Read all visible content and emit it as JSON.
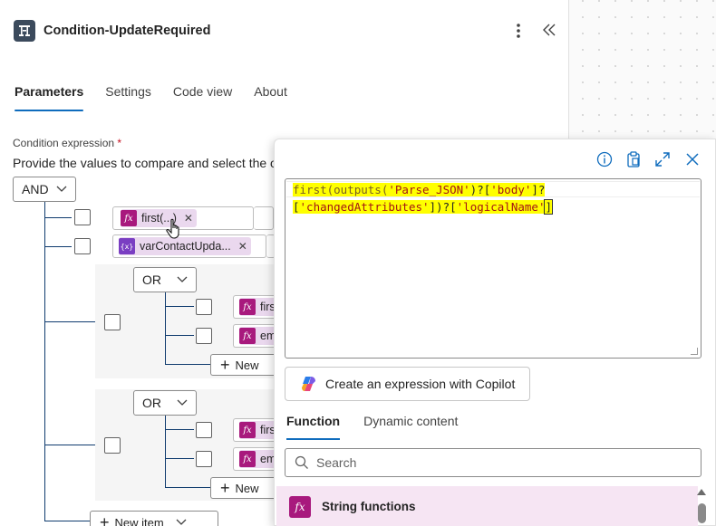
{
  "header": {
    "title": "Condition-UpdateRequired",
    "more_icon": "more-vertical-icon",
    "collapse_icon": "collapse-double-chevron-icon"
  },
  "tabs": [
    {
      "label": "Parameters",
      "active": true
    },
    {
      "label": "Settings",
      "active": false
    },
    {
      "label": "Code view",
      "active": false
    },
    {
      "label": "About",
      "active": false
    }
  ],
  "condition": {
    "label": "Condition expression",
    "required_mark": "*",
    "hint": "Provide the values to compare and select the o",
    "root_operator": "AND",
    "rows": [
      {
        "token_label": "first(...)",
        "token_type": "fx"
      },
      {
        "token_label": "varContactUpda...",
        "token_type": "var"
      }
    ],
    "groups": [
      {
        "operator": "OR",
        "rows": [
          {
            "token_label": "firs"
          },
          {
            "token_label": "em"
          }
        ],
        "new_label": "New"
      },
      {
        "operator": "OR",
        "rows": [
          {
            "token_label": "firs"
          },
          {
            "token_label": "em"
          }
        ],
        "new_label": "New"
      }
    ],
    "new_item_label": "New item"
  },
  "popup": {
    "code_line1": {
      "fn": "first(outputs(",
      "str1": "'Parse_JSON'",
      "mid": ")?[",
      "str2": "'body'",
      "end": "]?"
    },
    "code_line2": {
      "open": "[",
      "str1": "'changedAttributes'",
      "mid": "])?[",
      "str2": "'logicalName'",
      "end": "]"
    },
    "copilot_label": "Create an expression with Copilot",
    "tabs": [
      {
        "label": "Function",
        "active": true
      },
      {
        "label": "Dynamic content",
        "active": false
      }
    ],
    "search_placeholder": "Search",
    "function_group_label": "String functions"
  },
  "colors": {
    "accent": "#0f6cbd",
    "fx_token": "#a8197d",
    "var_token": "#7a3ec2",
    "token_bg": "#ead8ee",
    "highlight": "#ffff00"
  }
}
